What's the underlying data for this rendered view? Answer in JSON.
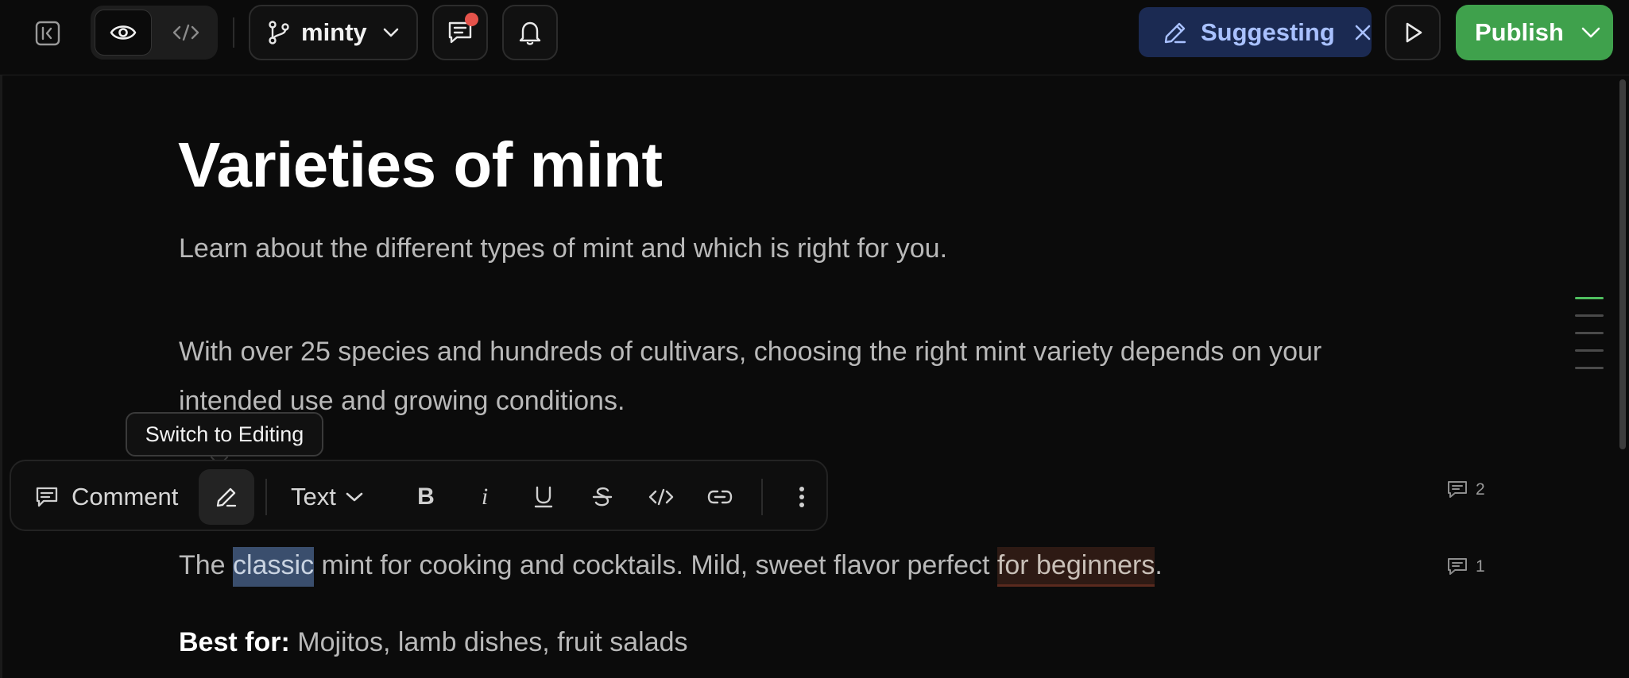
{
  "topbar": {
    "branch_name": "minty",
    "mode_label": "Suggesting",
    "publish_label": "Publish"
  },
  "tooltip": {
    "text": "Switch to Editing"
  },
  "toolbar": {
    "comment_label": "Comment",
    "text_style_label": "Text",
    "bold_glyph": "B",
    "italic_glyph": "i"
  },
  "document": {
    "title": "Varieties of mint",
    "subtitle": "Learn about the different types of mint and which is right for you.",
    "intro": "With over 25 species and hundreds of cultivars, choosing the right mint variety depends on your intended use and growing conditions.",
    "line": {
      "before": "The ",
      "selected": "classic",
      "middle": " mint for cooking and cocktails. Mild, sweet flavor perfect ",
      "suggested": "for beginners",
      "after": "."
    },
    "best_for_label": "Best for:",
    "best_for_value": " Mojitos, lamb dishes, fruit salads"
  },
  "comments": {
    "block_count": "2",
    "line_count": "1"
  },
  "colors": {
    "publish": "#3fa14c",
    "suggesting_bg": "#1b2a52",
    "suggesting_text": "#a9c1ff",
    "notify_dot": "#e5534b",
    "outline_active": "#4fbf5f"
  },
  "icons": [
    "sidebar-collapse-icon",
    "eye-icon",
    "code-icon",
    "branch-icon",
    "chevron-down-icon",
    "comments-icon",
    "bell-icon",
    "pencil-icon",
    "close-icon",
    "play-icon",
    "comment-icon",
    "bold-icon",
    "italic-icon",
    "underline-icon",
    "strikethrough-icon",
    "link-icon",
    "more-vertical-icon"
  ]
}
